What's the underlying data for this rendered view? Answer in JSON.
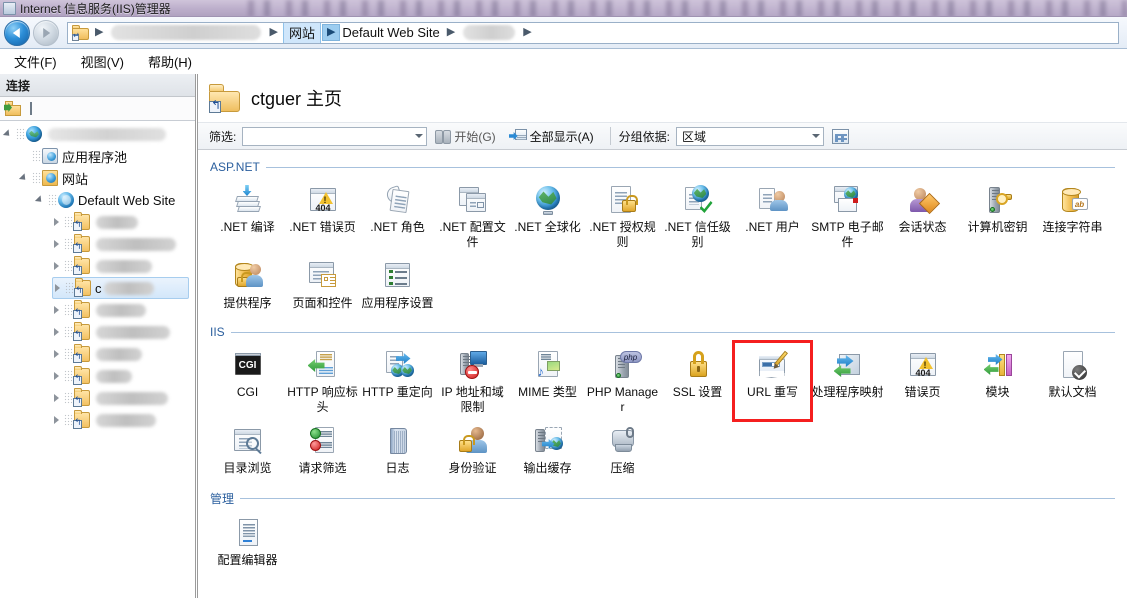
{
  "window": {
    "title": "Internet 信息服务(IIS)管理器",
    "icon": "iis-manager-icon"
  },
  "nav": {
    "back": "back-arrow",
    "forward": "forward-arrow",
    "breadcrumb": [
      {
        "type": "folder-icon",
        "label": ""
      },
      {
        "type": "redacted",
        "label": ""
      },
      {
        "type": "text",
        "label": "网站",
        "selected": true
      },
      {
        "type": "text",
        "label": "Default Web Site",
        "selected": false
      },
      {
        "type": "redacted",
        "label": ""
      }
    ]
  },
  "menu": {
    "items": [
      {
        "label": "文件(F)"
      },
      {
        "label": "视图(V)"
      },
      {
        "label": "帮助(H)"
      }
    ]
  },
  "sidebar": {
    "header": "连接",
    "toolbar": {
      "connect_icon": "connect-folder-icon"
    },
    "tree": [
      {
        "level": 0,
        "icon": "server-icon",
        "label": "",
        "redacted": true,
        "redact_w": 118,
        "twist": "open"
      },
      {
        "level": 1,
        "icon": "apppool-icon",
        "label": "应用程序池",
        "redacted": false,
        "twist": "none"
      },
      {
        "level": 1,
        "icon": "sites-icon",
        "label": "网站",
        "redacted": false,
        "twist": "open"
      },
      {
        "level": 2,
        "icon": "website-icon",
        "label": "Default Web Site",
        "redacted": false,
        "twist": "open"
      },
      {
        "level": 3,
        "icon": "appfolder-icon",
        "label": "",
        "redacted": true,
        "redact_w": 42,
        "twist": "closed"
      },
      {
        "level": 3,
        "icon": "appfolder-icon",
        "label": "",
        "redacted": true,
        "redact_w": 80,
        "twist": "closed"
      },
      {
        "level": 3,
        "icon": "appfolder-icon",
        "label": "",
        "redacted": true,
        "redact_w": 56,
        "twist": "closed"
      },
      {
        "level": 3,
        "icon": "appfolder-icon",
        "label": "c",
        "redacted": true,
        "redact_w": 50,
        "twist": "closed",
        "selected": true
      },
      {
        "level": 3,
        "icon": "appfolder-icon",
        "label": "",
        "redacted": true,
        "redact_w": 50,
        "twist": "closed"
      },
      {
        "level": 3,
        "icon": "appfolder-icon",
        "label": "",
        "redacted": true,
        "redact_w": 74,
        "twist": "closed"
      },
      {
        "level": 3,
        "icon": "appfolder-icon",
        "label": "",
        "redacted": true,
        "redact_w": 46,
        "twist": "closed"
      },
      {
        "level": 3,
        "icon": "appfolder-icon",
        "label": "",
        "redacted": true,
        "redact_w": 36,
        "twist": "closed"
      },
      {
        "level": 3,
        "icon": "appfolder-icon",
        "label": "",
        "redacted": true,
        "redact_w": 72,
        "twist": "closed"
      },
      {
        "level": 3,
        "icon": "appfolder-icon",
        "label": "",
        "redacted": true,
        "redact_w": 60,
        "twist": "closed"
      }
    ]
  },
  "content": {
    "page_title": "ctguer 主页",
    "page_icon": "folder-app-icon",
    "toolbar": {
      "filter_label": "筛选:",
      "filter_value": "",
      "filter_placeholder": "",
      "start_label": "开始(G)",
      "start_icon": "binoculars-icon",
      "showall_label": "全部显示(A)",
      "showall_icon": "show-all-icon",
      "groupby_label": "分组依据:",
      "groupby_value": "区域",
      "view_icon": "view-mode-icon"
    },
    "groups": [
      {
        "name": "ASP.NET",
        "items": [
          {
            "label": ".NET 编译",
            "icon": "net-compilation-icon"
          },
          {
            "label": ".NET 错误页",
            "icon": "net-error-pages-icon"
          },
          {
            "label": ".NET 角色",
            "icon": "net-roles-icon"
          },
          {
            "label": ".NET 配置文件",
            "icon": "net-profile-icon"
          },
          {
            "label": ".NET 全球化",
            "icon": "net-globalization-icon"
          },
          {
            "label": ".NET 授权规则",
            "icon": "net-authorization-rules-icon"
          },
          {
            "label": ".NET 信任级别",
            "icon": "net-trust-levels-icon"
          },
          {
            "label": ".NET 用户",
            "icon": "net-users-icon"
          },
          {
            "label": "SMTP 电子邮件",
            "icon": "smtp-email-icon"
          },
          {
            "label": "会话状态",
            "icon": "session-state-icon"
          },
          {
            "label": "计算机密钥",
            "icon": "machine-key-icon"
          },
          {
            "label": "连接字符串",
            "icon": "connection-strings-icon"
          },
          {
            "label": "提供程序",
            "icon": "providers-icon"
          },
          {
            "label": "页面和控件",
            "icon": "pages-and-controls-icon"
          },
          {
            "label": "应用程序设置",
            "icon": "application-settings-icon"
          }
        ]
      },
      {
        "name": "IIS",
        "items": [
          {
            "label": "CGI",
            "icon": "cgi-icon"
          },
          {
            "label": "HTTP 响应标头",
            "icon": "http-response-headers-icon"
          },
          {
            "label": "HTTP 重定向",
            "icon": "http-redirect-icon"
          },
          {
            "label": "IP 地址和域限制",
            "icon": "ip-address-domain-restrictions-icon"
          },
          {
            "label": "MIME 类型",
            "icon": "mime-types-icon"
          },
          {
            "label": "PHP Manager",
            "icon": "php-manager-icon"
          },
          {
            "label": "SSL 设置",
            "icon": "ssl-settings-icon"
          },
          {
            "label": "URL 重写",
            "icon": "url-rewrite-icon",
            "highlight": true
          },
          {
            "label": "处理程序映射",
            "icon": "handler-mappings-icon"
          },
          {
            "label": "错误页",
            "icon": "error-pages-icon"
          },
          {
            "label": "模块",
            "icon": "modules-icon"
          },
          {
            "label": "默认文档",
            "icon": "default-document-icon"
          },
          {
            "label": "目录浏览",
            "icon": "directory-browsing-icon"
          },
          {
            "label": "请求筛选",
            "icon": "request-filtering-icon"
          },
          {
            "label": "日志",
            "icon": "logging-icon"
          },
          {
            "label": "身份验证",
            "icon": "authentication-icon"
          },
          {
            "label": "输出缓存",
            "icon": "output-caching-icon"
          },
          {
            "label": "压缩",
            "icon": "compression-icon"
          }
        ]
      },
      {
        "name": "管理",
        "items": [
          {
            "label": "配置编辑器",
            "icon": "configuration-editor-icon"
          }
        ]
      }
    ]
  },
  "colors": {
    "highlight_box": "#f51f1f",
    "group_title": "#2b5f9e",
    "titlebar": "#b9abc8"
  }
}
